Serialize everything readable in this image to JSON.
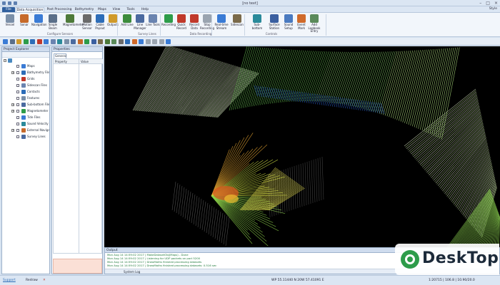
{
  "window": {
    "title": "[no text]",
    "buttons": [
      "–",
      "□",
      "×"
    ]
  },
  "ribbon_tabs": [
    "File",
    "Data Acquisition",
    "Post Processing",
    "Bathymetry",
    "Maps",
    "View",
    "Tools",
    "Help"
  ],
  "style_label": "Style",
  "ribbon": {
    "buttons": [
      {
        "label": "Vessel",
        "color": "#7a8fa8"
      },
      {
        "label": "Sonar",
        "color": "#c66a2a"
      },
      {
        "label": "Navigation",
        "color": "#3a7bd5"
      },
      {
        "label": "Single Beam",
        "color": "#5a6f8a"
      },
      {
        "label": "Magnetometer",
        "color": "#4d7a3a"
      },
      {
        "label": "Motion Sensor",
        "color": "#6a6a6a"
      },
      {
        "label": "Cable Payout",
        "color": "#2d6db8"
      },
      {
        "label": "Outputs",
        "color": "#d09a2a"
      },
      {
        "label": "Add Line",
        "color": "#3c8c3c"
      },
      {
        "label": "Line Manager",
        "color": "#4a6aa0"
      },
      {
        "label": "Line Tools",
        "color": "#6a84b0"
      },
      {
        "label": "Recording",
        "color": "#2d9c4a"
      },
      {
        "label": "Quick Record",
        "color": "#c0392b"
      },
      {
        "label": "Record Data",
        "color": "#c0392b"
      },
      {
        "label": "Stop Recording",
        "color": "#9aa4b0"
      },
      {
        "label": "Real-time Stream",
        "color": "#3a7bd5"
      },
      {
        "label": "Sidescan",
        "color": "#7a6a4a"
      },
      {
        "label": "Sub-bottom",
        "color": "#2a8a9a"
      },
      {
        "label": "Surface Station",
        "color": "#3a5fa0"
      },
      {
        "label": "Sound Setup",
        "color": "#4a7ac0"
      },
      {
        "label": "Event Mark",
        "color": "#d06a2a"
      },
      {
        "label": "Add Logbook Entry",
        "color": "#5a8a5a"
      }
    ],
    "groups": [
      "Configure Sensors",
      "Survey Lines",
      "Data Recording",
      "Controls"
    ]
  },
  "project_explorer": {
    "title": "Project Explorer",
    "items": [
      {
        "label": "Maps",
        "color": "#3a7bd5",
        "indent": 0
      },
      {
        "label": "Bathymetry Files",
        "color": "#2d6db8",
        "indent": 0
      },
      {
        "label": "Grids",
        "color": "#c0392b",
        "indent": 0
      },
      {
        "label": "Sidescan Files",
        "color": "#6a84b0",
        "indent": 0
      },
      {
        "label": "Contacts",
        "color": "#2d6db8",
        "indent": 0
      },
      {
        "label": "Features",
        "color": "#7a8fa8",
        "indent": 0
      },
      {
        "label": "Sub-bottom Files",
        "color": "#4a6aa0",
        "indent": 0
      },
      {
        "label": "Magnetometer Files",
        "color": "#2d9c4a",
        "indent": 0
      },
      {
        "label": "Tide Files",
        "color": "#3a7bd5",
        "indent": 0
      },
      {
        "label": "Sound Velocity Profiles",
        "color": "#2a8a9a",
        "indent": 0
      },
      {
        "label": "External Navigation",
        "color": "#c66a2a",
        "indent": 0
      },
      {
        "label": "Survey Lines",
        "color": "#4a6aa0",
        "indent": 0
      }
    ]
  },
  "properties": {
    "title": "Properties",
    "tab": "General",
    "col_property": "Property",
    "col_value": "Value"
  },
  "output": {
    "title": "Output",
    "lines": [
      "Mon Aug 14 14:59:02 2017 | MakeDatasetObj(Maps) - Done",
      "Mon Aug 14 14:59:02 2017 | Listening for UDP packets on port 5200",
      "Mon Aug 14 14:59:02 2017 | DrawMaths finished processing datasets",
      "Mon Aug 14 14:59:02 2017 | DrawMaths finished processing datasets: 0.516 sec"
    ],
    "tab_label": "System Log"
  },
  "status": {
    "support": "Support",
    "redraw": "Redraw",
    "coords": "WP 55.11440 N 20W 57.41091 E",
    "right": "1:20715 | 106.8 | 10.90/20.0"
  },
  "watermark": {
    "text": "DeskTop"
  }
}
